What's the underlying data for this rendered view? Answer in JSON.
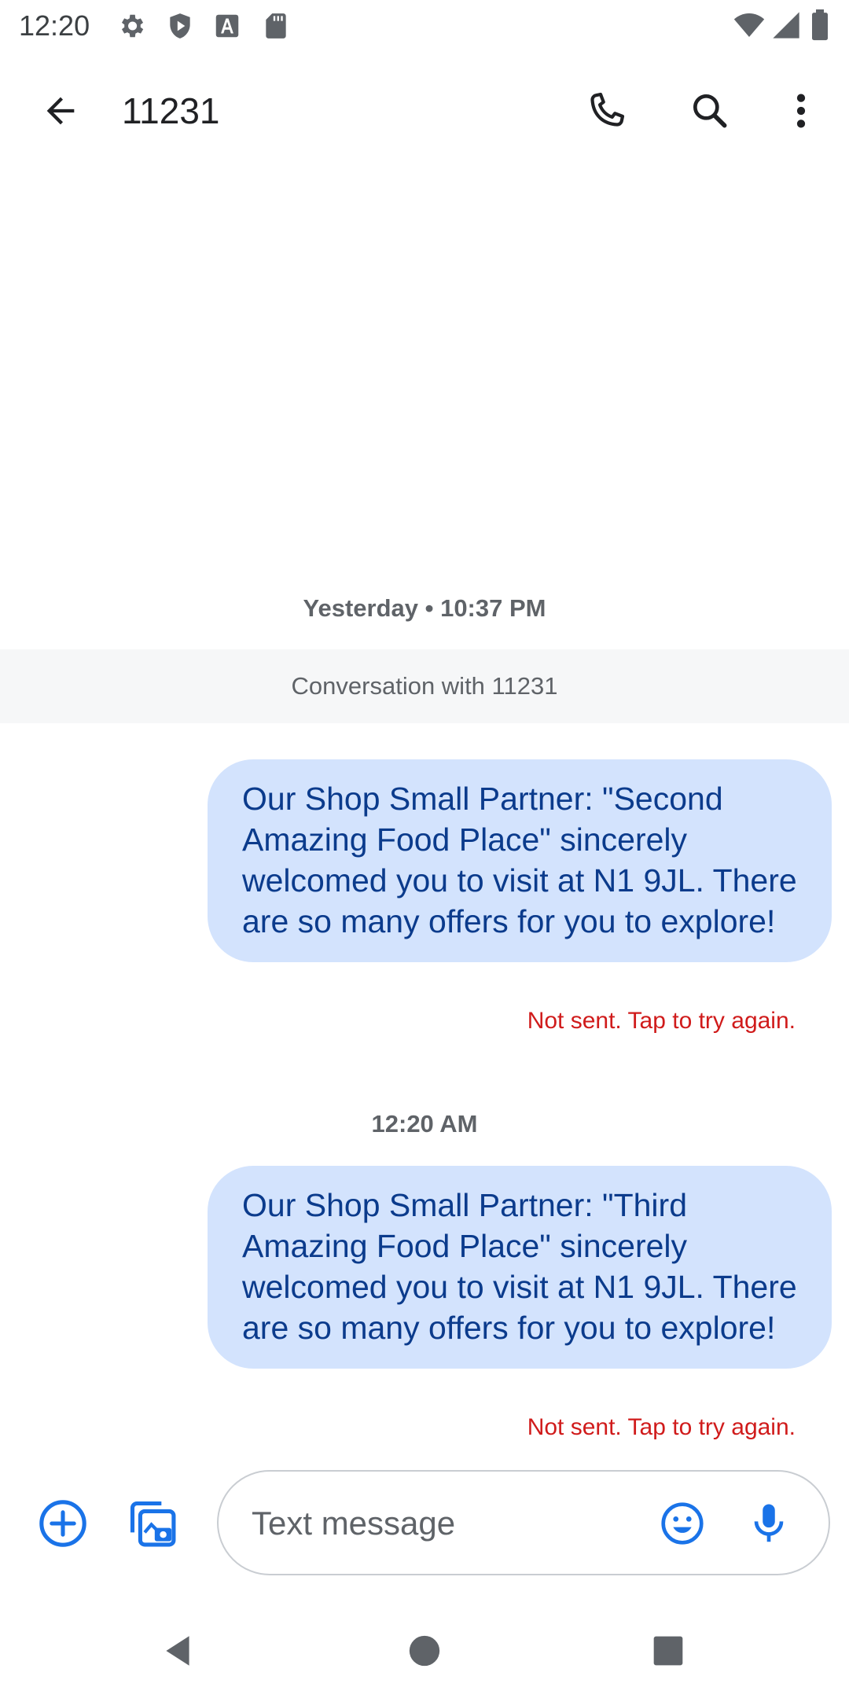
{
  "status_bar": {
    "time": "12:20"
  },
  "header": {
    "title": "11231"
  },
  "conversation": {
    "first_timestamp": "Yesterday • 10:37 PM",
    "banner": "Conversation with 11231",
    "messages": [
      {
        "text": "Our Shop Small Partner: \"Second Amazing Food Place\" sincerely welcomed you to visit at N1 9JL. There are so many offers for you to explore!",
        "status": "Not sent. Tap to try again."
      },
      {
        "text": "Our Shop Small Partner: \"Third Amazing Food Place\" sincerely welcomed you to visit at N1 9JL. There are so many offers for you to explore!",
        "status": "Not sent. Tap to try again."
      }
    ],
    "second_timestamp": "12:20 AM"
  },
  "composer": {
    "placeholder": "Text message"
  },
  "colors": {
    "accent": "#1a73e8",
    "bubble": "#d3e3fd",
    "bubble_text": "#0b3b8c",
    "error": "#d01b1b"
  }
}
